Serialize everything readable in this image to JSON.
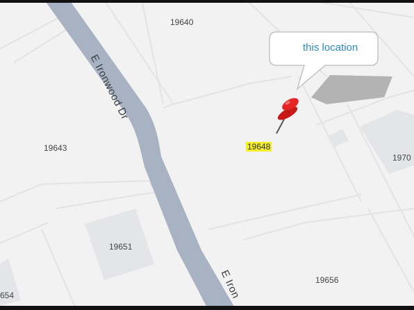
{
  "map": {
    "street_name": "E Ironwood Dr",
    "street_name_lower": "E Iron",
    "lots": {
      "lot_19640": "19640",
      "lot_19643": "19643",
      "lot_19648": "19648",
      "lot_19651": "19651",
      "lot_19656": "19656",
      "lot_19703": "1970",
      "lot_19654": "654"
    },
    "callout": {
      "text": "this location",
      "text_color": "#2a8bbf"
    },
    "marker": {
      "icon": "pushpin-icon",
      "color": "#d42020"
    },
    "highlight_color": "#f4ef2a",
    "road_color": "#a7b2c2",
    "background_color": "#f2f2f2"
  }
}
